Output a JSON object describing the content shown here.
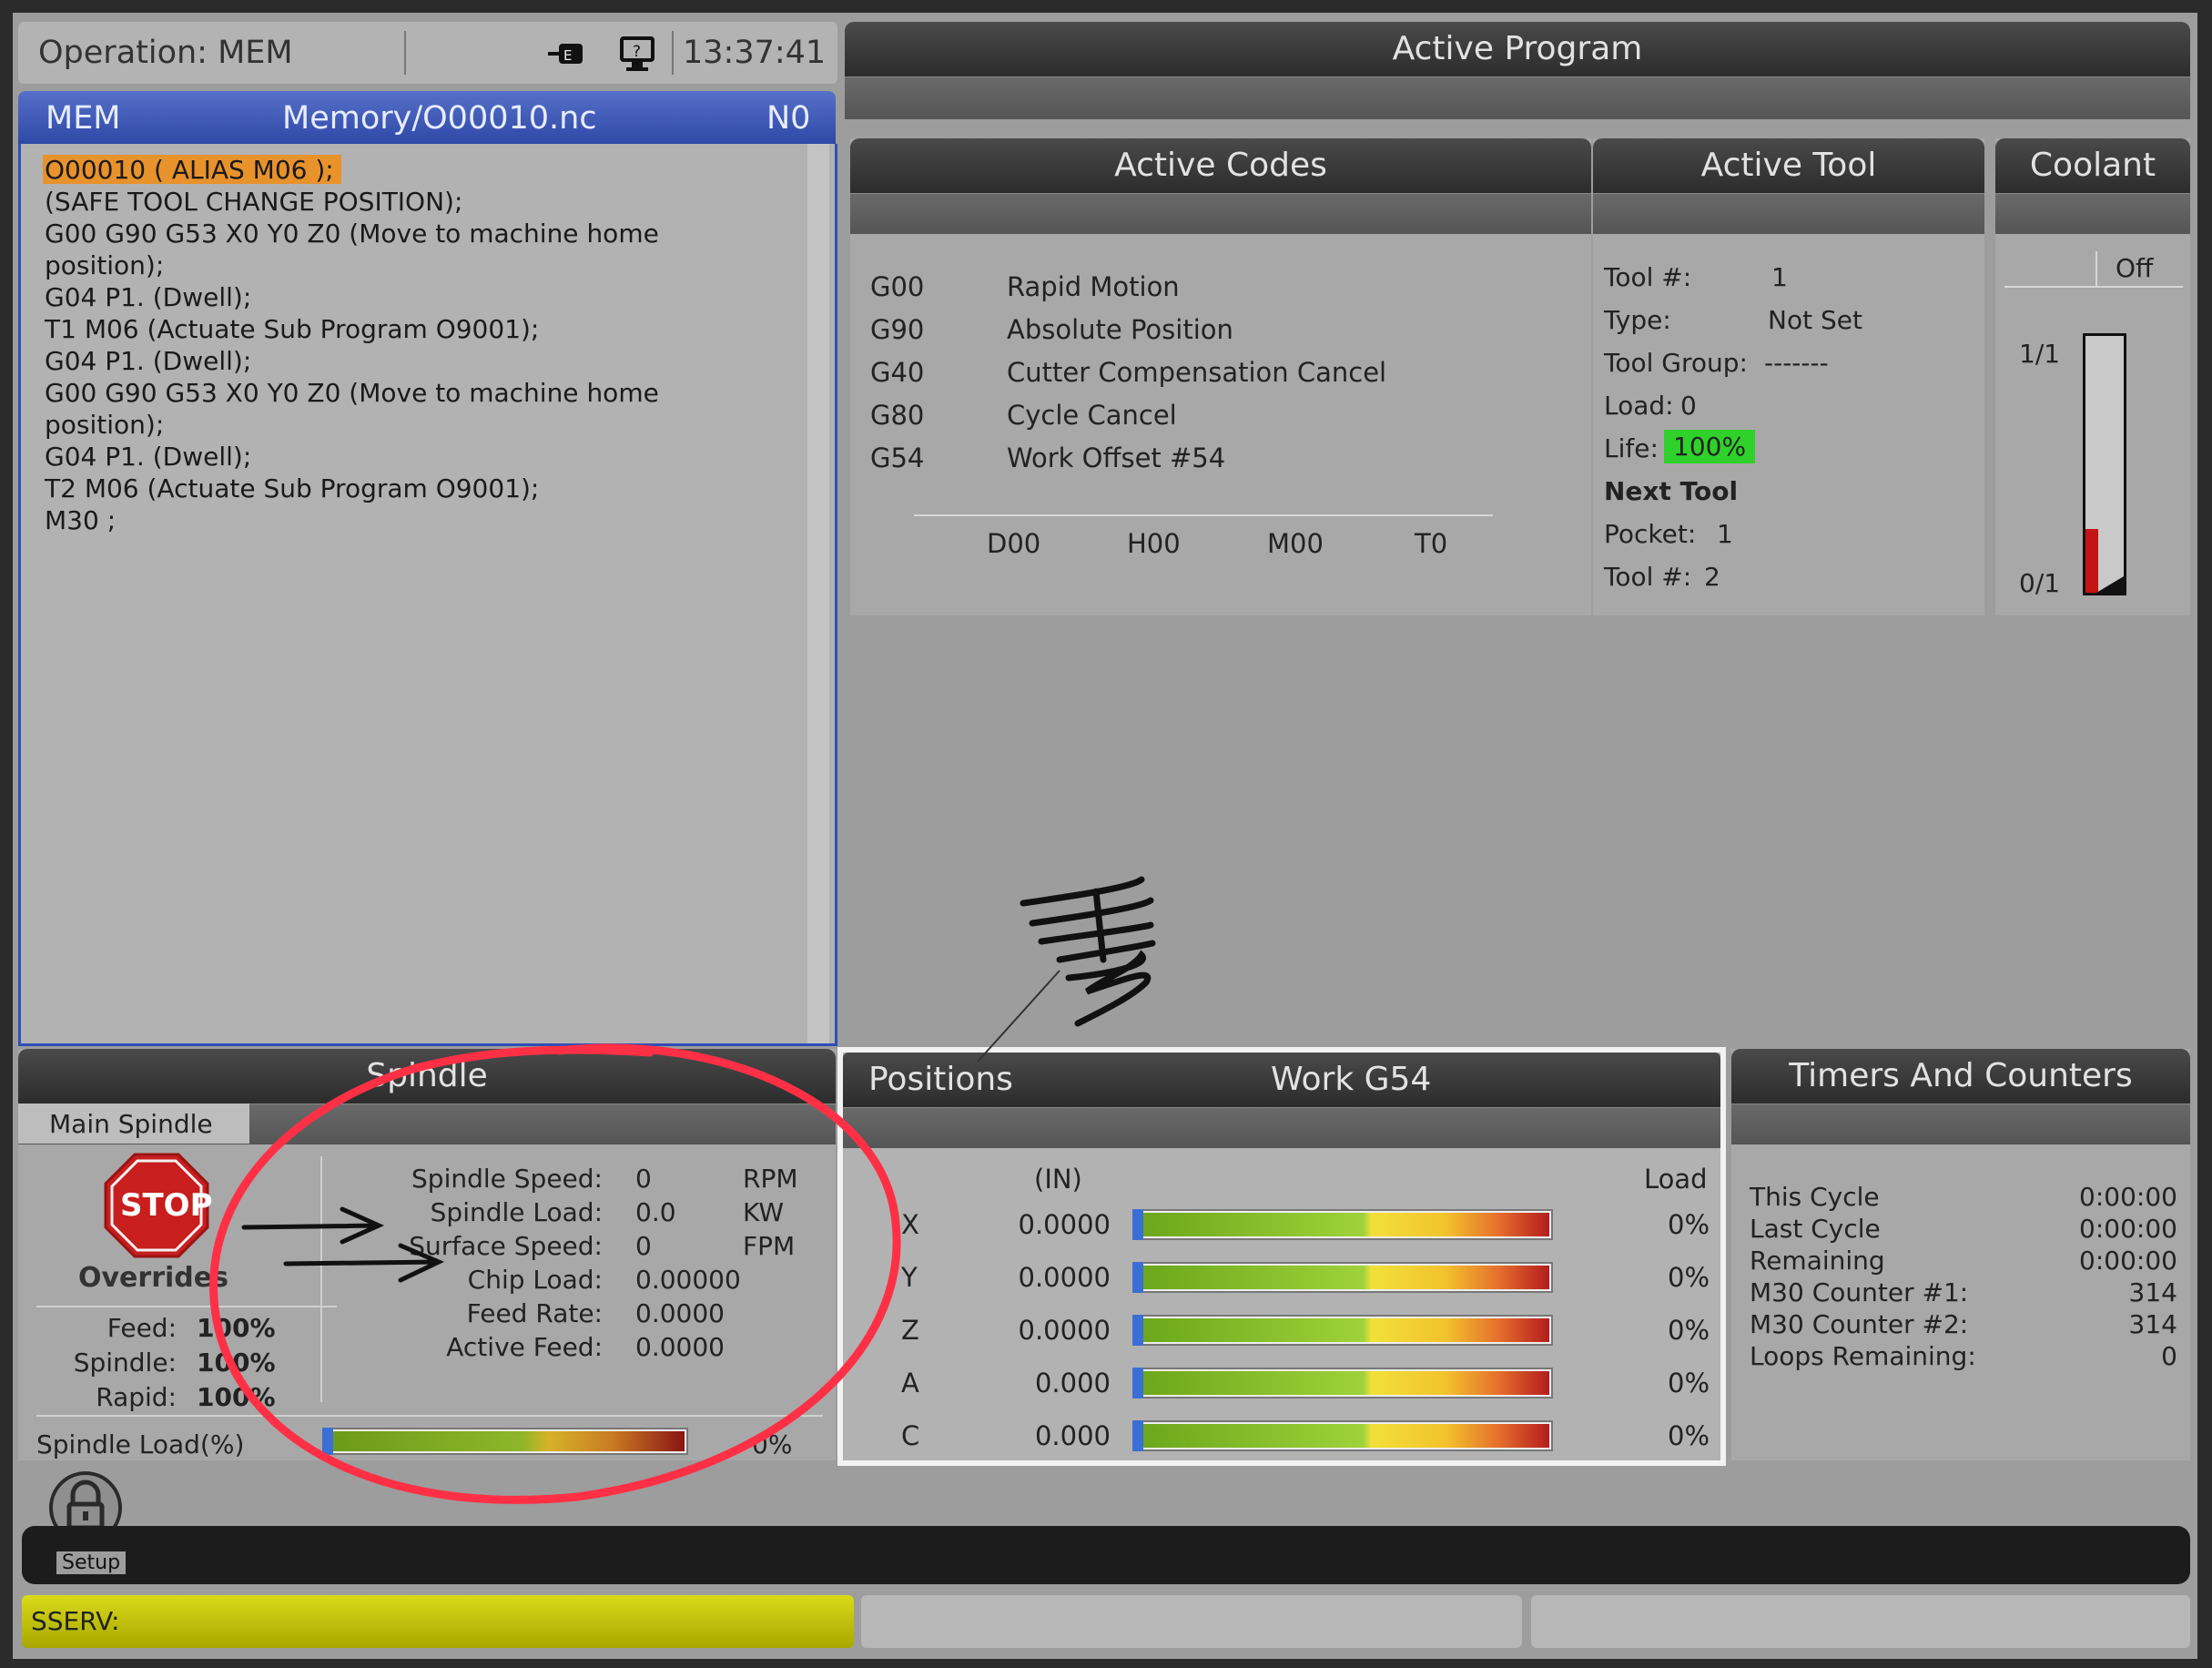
{
  "status": {
    "operation": "Operation: MEM",
    "time": "13:37:41",
    "icons": [
      "network-icon",
      "remote-display-icon"
    ]
  },
  "program": {
    "mode": "MEM",
    "path": "Memory/O00010.nc",
    "line_no": "N0",
    "lines": [
      "O00010 ( ALIAS M06 );",
      "(SAFE TOOL CHANGE POSITION);",
      "G00 G90 G53 X0 Y0 Z0 (Move to machine home",
      "position);",
      "G04 P1. (Dwell);",
      "T1 M06 (Actuate Sub Program O9001);",
      "G04 P1. (Dwell);",
      "G00 G90 G53 X0 Y0 Z0 (Move to machine home",
      "position);",
      "G04 P1. (Dwell);",
      "T2 M06 (Actuate Sub Program O9001);",
      "M30 ;"
    ],
    "highlight_color": "#e8922c"
  },
  "active_program": {
    "title": "Active Program"
  },
  "active_codes": {
    "title": "Active Codes",
    "codes": [
      {
        "code": "G00",
        "desc": "Rapid Motion"
      },
      {
        "code": "G90",
        "desc": "Absolute Position"
      },
      {
        "code": "G40",
        "desc": "Cutter Compensation Cancel"
      },
      {
        "code": "G80",
        "desc": "Cycle Cancel"
      },
      {
        "code": "G54",
        "desc": "Work Offset #54"
      }
    ],
    "footer": [
      "D00",
      "H00",
      "M00",
      "T0"
    ]
  },
  "active_tool": {
    "title": "Active Tool",
    "tool_label": "Tool #:",
    "tool_value": "1",
    "type_label": "Type:",
    "type_value": "Not Set",
    "group_label": "Tool Group:",
    "group_value": "-------",
    "load_label": "Load:",
    "load_value": "0",
    "life_label": "Life:",
    "life_value": "100%",
    "next_label": "Next Tool",
    "pocket_label": "Pocket:",
    "pocket_value": "1",
    "next_tool_label": "Tool #:",
    "next_tool_value": "2",
    "life_color": "#2fd12a"
  },
  "coolant": {
    "title": "Coolant",
    "state": "Off",
    "top_label": "1/1",
    "bottom_label": "0/1",
    "level_fraction": 0.25
  },
  "spindle": {
    "title": "Spindle",
    "tab": "Main Spindle",
    "stop_label": "STOP",
    "overrides_label": "Overrides",
    "overrides": [
      {
        "label": "Feed:",
        "value": "100%"
      },
      {
        "label": "Spindle:",
        "value": "100%"
      },
      {
        "label": "Rapid:",
        "value": "100%"
      }
    ],
    "readouts": [
      {
        "label": "Spindle Speed:",
        "value": "0",
        "unit": "RPM"
      },
      {
        "label": "Spindle Load:",
        "value": "0.0",
        "unit": "KW"
      },
      {
        "label": "Surface Speed:",
        "value": "0",
        "unit": "FPM"
      },
      {
        "label": "Chip Load:",
        "value": "0.00000",
        "unit": ""
      },
      {
        "label": "Feed Rate:",
        "value": "0.0000",
        "unit": ""
      },
      {
        "label": "Active Feed:",
        "value": "0.0000",
        "unit": ""
      }
    ],
    "load_label": "Spindle Load(%)",
    "load_value": "0%",
    "load_fraction": 0
  },
  "positions": {
    "title": "Positions",
    "mode": "Work G54",
    "units": "(IN)",
    "load_header": "Load",
    "axes": [
      {
        "axis": "X",
        "value": "0.0000",
        "load": "0%"
      },
      {
        "axis": "Y",
        "value": "0.0000",
        "load": "0%"
      },
      {
        "axis": "Z",
        "value": "0.0000",
        "load": "0%"
      },
      {
        "axis": "A",
        "value": "0.000",
        "load": "0%"
      },
      {
        "axis": "C",
        "value": "0.000",
        "load": "0%"
      }
    ]
  },
  "timers": {
    "title": "Timers And Counters",
    "rows": [
      {
        "label": "This Cycle",
        "value": "0:00:00"
      },
      {
        "label": "Last Cycle",
        "value": "0:00:00"
      },
      {
        "label": "Remaining",
        "value": "0:00:00"
      },
      {
        "label": "M30 Counter #1:",
        "value": "314"
      },
      {
        "label": "M30 Counter #2:",
        "value": "314"
      },
      {
        "label": "Loops Remaining:",
        "value": "0"
      }
    ]
  },
  "setup": {
    "label": "Setup",
    "icon": "padlock-icon"
  },
  "alarm": {
    "text": "SSERV:",
    "color": "#c4c400"
  },
  "annotations": {
    "circle_color": "#ff3045",
    "ink_color": "#111111"
  }
}
